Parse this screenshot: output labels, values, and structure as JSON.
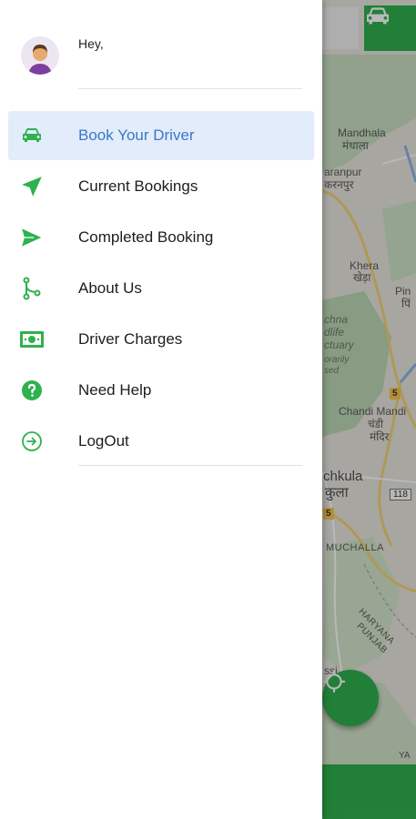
{
  "drawer": {
    "greeting": "Hey,",
    "items": [
      {
        "label": "Book Your Driver",
        "icon": "car-icon",
        "active": true
      },
      {
        "label": "Current Bookings",
        "icon": "send-icon",
        "active": false
      },
      {
        "label": "Completed Booking",
        "icon": "paper-plane-icon",
        "active": false
      },
      {
        "label": "About Us",
        "icon": "fork-icon",
        "active": false
      },
      {
        "label": "Driver Charges",
        "icon": "money-icon",
        "active": false
      },
      {
        "label": "Need Help",
        "icon": "help-icon",
        "active": false
      },
      {
        "label": "LogOut",
        "icon": "logout-icon",
        "active": false
      }
    ]
  },
  "map": {
    "labels": {
      "mandhala_en": "Mandhala",
      "mandhala_hi": "मंधाला",
      "karanpur_en": "aranpur",
      "karanpur_hi": "करनपुर",
      "khera_en": "Khera",
      "khera_hi": "खेड़ा",
      "ping_en": "Pin",
      "ping_hi": "पिं",
      "sanctuary_1": "chna",
      "sanctuary_2": "dlife",
      "sanctuary_3": "ctuary",
      "sanctuary_4": "orarily",
      "sanctuary_5": "sed",
      "chandi_en": "Chandi Mandi",
      "chandi_hi_1": "चंडी",
      "chandi_hi_2": "मंदिर",
      "panchkula_en": "chkula",
      "panchkula_hi": "कुला",
      "muchalla": "MUCHALLA",
      "haryana": "HARYANA",
      "punjab": "PUNJAB",
      "ssi": "ssi",
      "ya": "YA",
      "shield_5a": "5",
      "shield_5b": "5",
      "route_118": "118"
    }
  },
  "colors": {
    "accent": "#2fb14e",
    "active_bg": "#e2ecfb",
    "active_text": "#3a78c9"
  }
}
